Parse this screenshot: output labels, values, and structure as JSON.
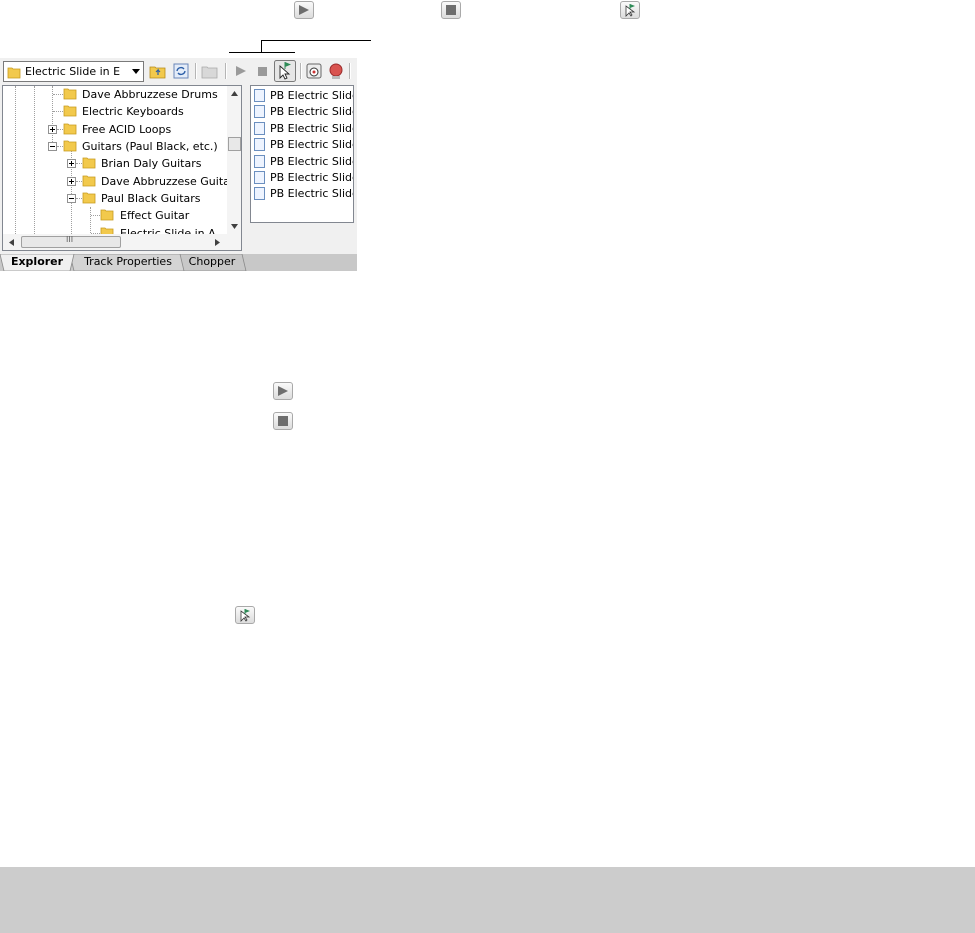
{
  "toolbar": {
    "folder_combo_value": "Electric Slide in E",
    "buttons": [
      "up-folder-icon",
      "refresh-icon",
      "new-folder-icon",
      "play-icon",
      "stop-icon",
      "auto-preview-icon",
      "start-preview-icon",
      "record-icon"
    ]
  },
  "tree": {
    "items": [
      {
        "label": "Dave Abbruzzese Drums"
      },
      {
        "label": "Electric Keyboards"
      },
      {
        "label": "Free ACID Loops"
      },
      {
        "label": "Guitars (Paul Black, etc.)"
      },
      {
        "label": "Brian Daly Guitars"
      },
      {
        "label": "Dave Abbruzzese Guitars"
      },
      {
        "label": "Paul Black Guitars"
      },
      {
        "label": "Effect Guitar"
      },
      {
        "label": "Electric Slide in A"
      }
    ],
    "scrollbar_glyph": "III"
  },
  "files": {
    "items": [
      {
        "label": "PB Electric Slide"
      },
      {
        "label": "PB Electric Slide"
      },
      {
        "label": "PB Electric Slide"
      },
      {
        "label": "PB Electric Slide"
      },
      {
        "label": "PB Electric Slide"
      },
      {
        "label": "PB Electric Slide"
      },
      {
        "label": "PB Electric Slide"
      }
    ]
  },
  "tabs": [
    {
      "label": "Explorer",
      "active": true
    },
    {
      "label": "Track Properties",
      "active": false
    },
    {
      "label": "Chopper",
      "active": false
    }
  ],
  "callout_icons": [
    "play-icon",
    "stop-icon",
    "auto-preview-icon"
  ],
  "colors": {
    "window_bg": "#f0f0f0",
    "folder_yellow": "#f2c94c",
    "footer_gray": "#cccccc",
    "preview_green": "#2e8b57"
  }
}
